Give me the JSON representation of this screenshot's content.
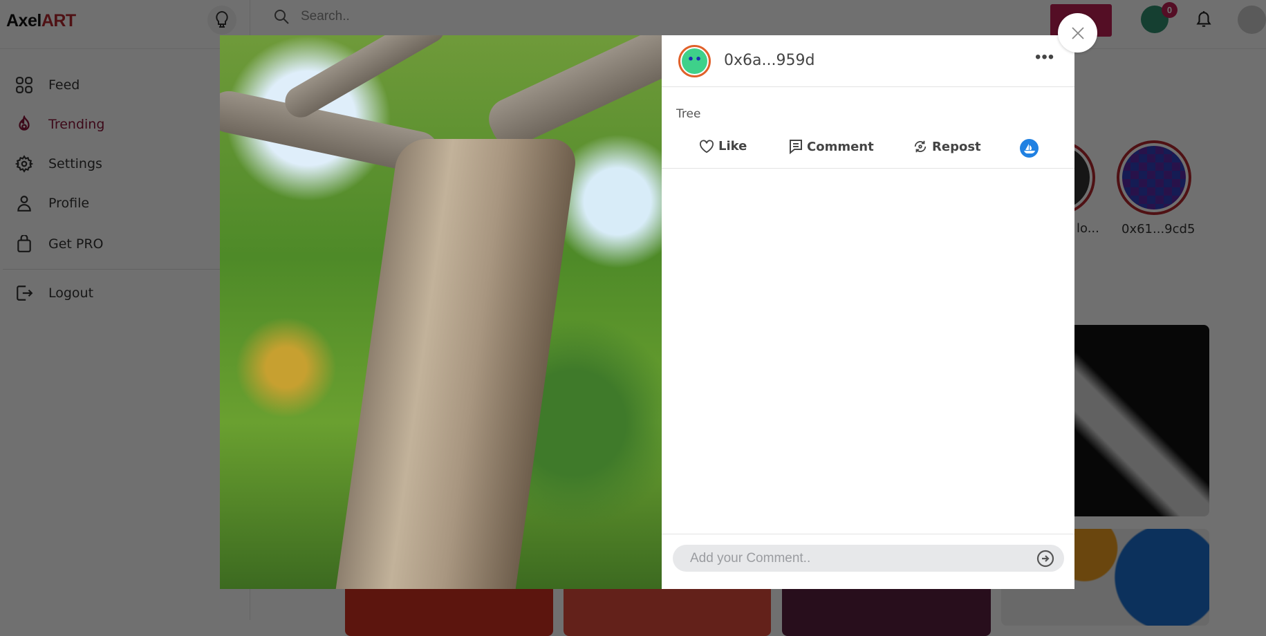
{
  "app": {
    "logo_part1": "Axel",
    "logo_part2": "ART"
  },
  "header": {
    "search_placeholder": "Search..",
    "cart_badge": "0"
  },
  "sidebar": {
    "items": [
      {
        "label": "Feed",
        "icon": "grid-icon"
      },
      {
        "label": "Trending",
        "icon": "flame-icon",
        "active": true
      },
      {
        "label": "Settings",
        "icon": "gear-icon"
      },
      {
        "label": "Profile",
        "icon": "user-icon"
      },
      {
        "label": "Get PRO",
        "icon": "shopping-bag-icon"
      },
      {
        "label": "Logout",
        "icon": "logout-icon"
      }
    ]
  },
  "stories": [
    {
      "label": "lo..."
    },
    {
      "label": "0x61...9cd5"
    }
  ],
  "modal": {
    "username": "0x6a...959d",
    "caption": "Tree",
    "actions": {
      "like": "Like",
      "comment": "Comment",
      "repost": "Repost"
    },
    "comment_placeholder": "Add your Comment.."
  },
  "colors": {
    "accent": "#8a1538",
    "opensea": "#2081e2"
  }
}
